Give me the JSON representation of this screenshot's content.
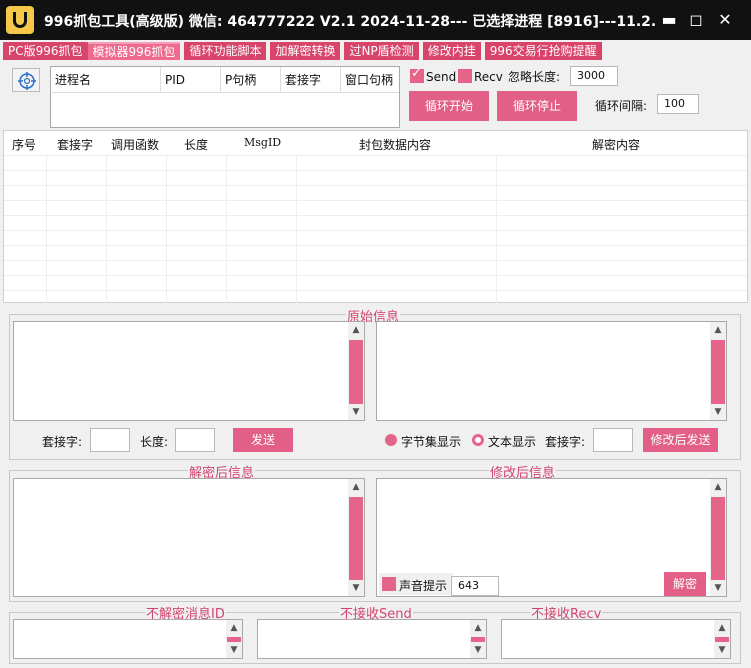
{
  "window": {
    "title": "996抓包工具(高级版)  微信: 464777222   V2.1   2024-11-28--- 已选择进程 [8916]---11.2...",
    "min_glyph": "▬",
    "max_glyph": "◻",
    "close_glyph": "✕"
  },
  "tabs": [
    {
      "label": "PC版996抓包",
      "active": false
    },
    {
      "label": "模拟器996抓包",
      "active": true
    },
    {
      "label": "循环功能脚本",
      "active": false
    },
    {
      "label": "加解密转换",
      "active": false
    },
    {
      "label": "过NP盾检测",
      "active": false
    },
    {
      "label": "修改内挂",
      "active": false
    },
    {
      "label": "996交易行抢购提醒",
      "active": false
    }
  ],
  "process_table": {
    "columns": [
      "进程名",
      "PID",
      "P句柄",
      "套接字",
      "窗口句柄"
    ]
  },
  "send_check": {
    "label": "Send",
    "checked": true
  },
  "recv_check": {
    "label": "Recv",
    "checked": false
  },
  "ignore_len": {
    "label": "忽略长度:",
    "value": "3000"
  },
  "loop_start": "循环开始",
  "loop_stop": "循环停止",
  "loop_interval": {
    "label": "循环间隔:",
    "value": "100"
  },
  "packet_table": {
    "columns": [
      "序号",
      "套接字",
      "调用函数",
      "长度",
      "MsgID",
      "封包数据内容",
      "解密内容"
    ]
  },
  "original_info": {
    "title": "原始信息",
    "socket_label": "套接字:",
    "length_label": "长度:",
    "send_button": "发送",
    "byteset_label": "字节集显示",
    "text_label": "文本显示",
    "socket_label2": "套接字:",
    "modify_send_button": "修改后发送"
  },
  "decrypted_info": {
    "title": "解密后信息"
  },
  "modified_info": {
    "title": "修改后信息",
    "sound_label": "声音提示",
    "sound_value": "643",
    "decrypt_button": "解密"
  },
  "bottom": {
    "no_decrypt_title": "不解密消息ID",
    "no_send_title": "不接收Send",
    "no_recv_title": "不接收Recv"
  },
  "colors": {
    "accent": "#e25f87",
    "title_text": "#d0466f"
  }
}
